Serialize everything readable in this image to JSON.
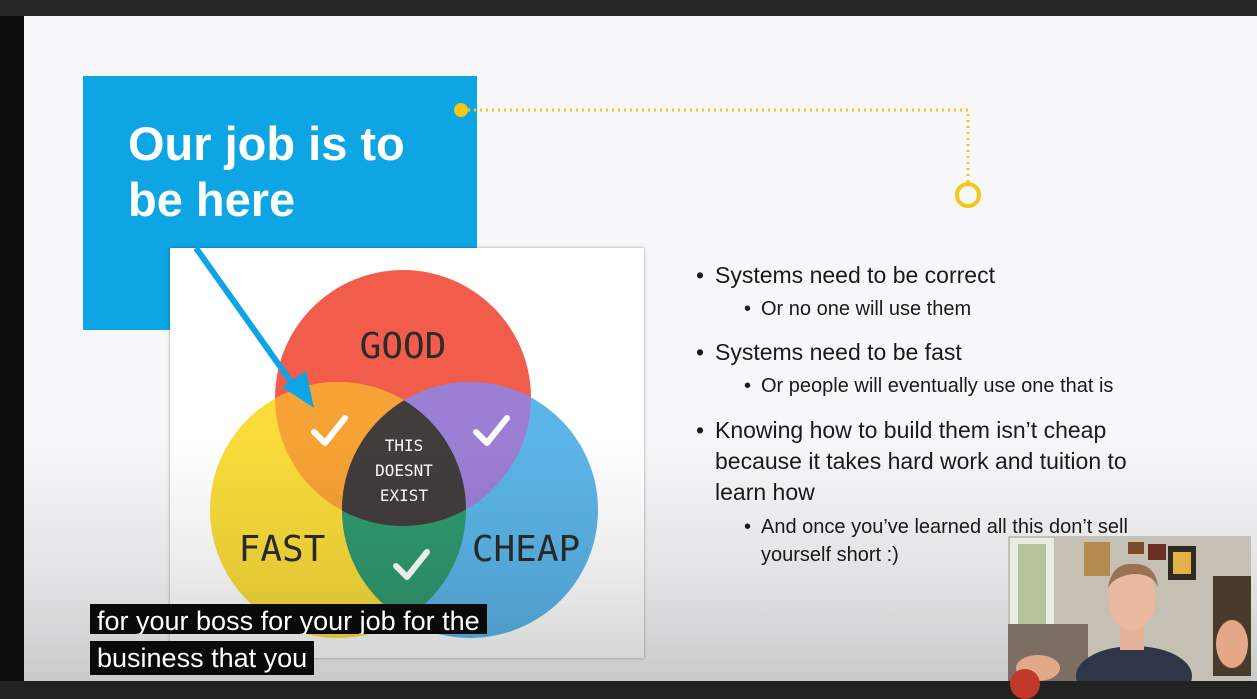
{
  "slide": {
    "title_line1": "Our job is to",
    "title_line2": "be here",
    "venn": {
      "circle_good": "GOOD",
      "circle_fast": "FAST",
      "circle_cheap": "CHEAP",
      "center_line1": "THIS",
      "center_line2": "DOESNT",
      "center_line3": "EXIST",
      "colors": {
        "good": "#f25c4a",
        "fast": "#f9dc3a",
        "cheap": "#5bb5e8",
        "good_fast": "#f7a234",
        "good_cheap": "#9b7fd4",
        "fast_cheap": "#2e9a6e",
        "center": "#433c3c"
      }
    },
    "accent_color": "#0ea5e4",
    "connector_color": "#f5c518",
    "bullets": [
      {
        "text": "Systems need to be correct",
        "sub": [
          "Or no one will use them"
        ]
      },
      {
        "text": "Systems need to be fast",
        "sub": [
          "Or people will eventually use one that is"
        ]
      },
      {
        "text_lines": [
          "Knowing how to build them isn’t cheap",
          "because it takes hard work and tuition to",
          "learn how"
        ],
        "sub_lines": [
          "And once you’ve learned all this don’t sell",
          "yourself short :)"
        ]
      }
    ]
  },
  "captions": {
    "line1": "for your boss for your job for the",
    "line2": "business that you"
  }
}
